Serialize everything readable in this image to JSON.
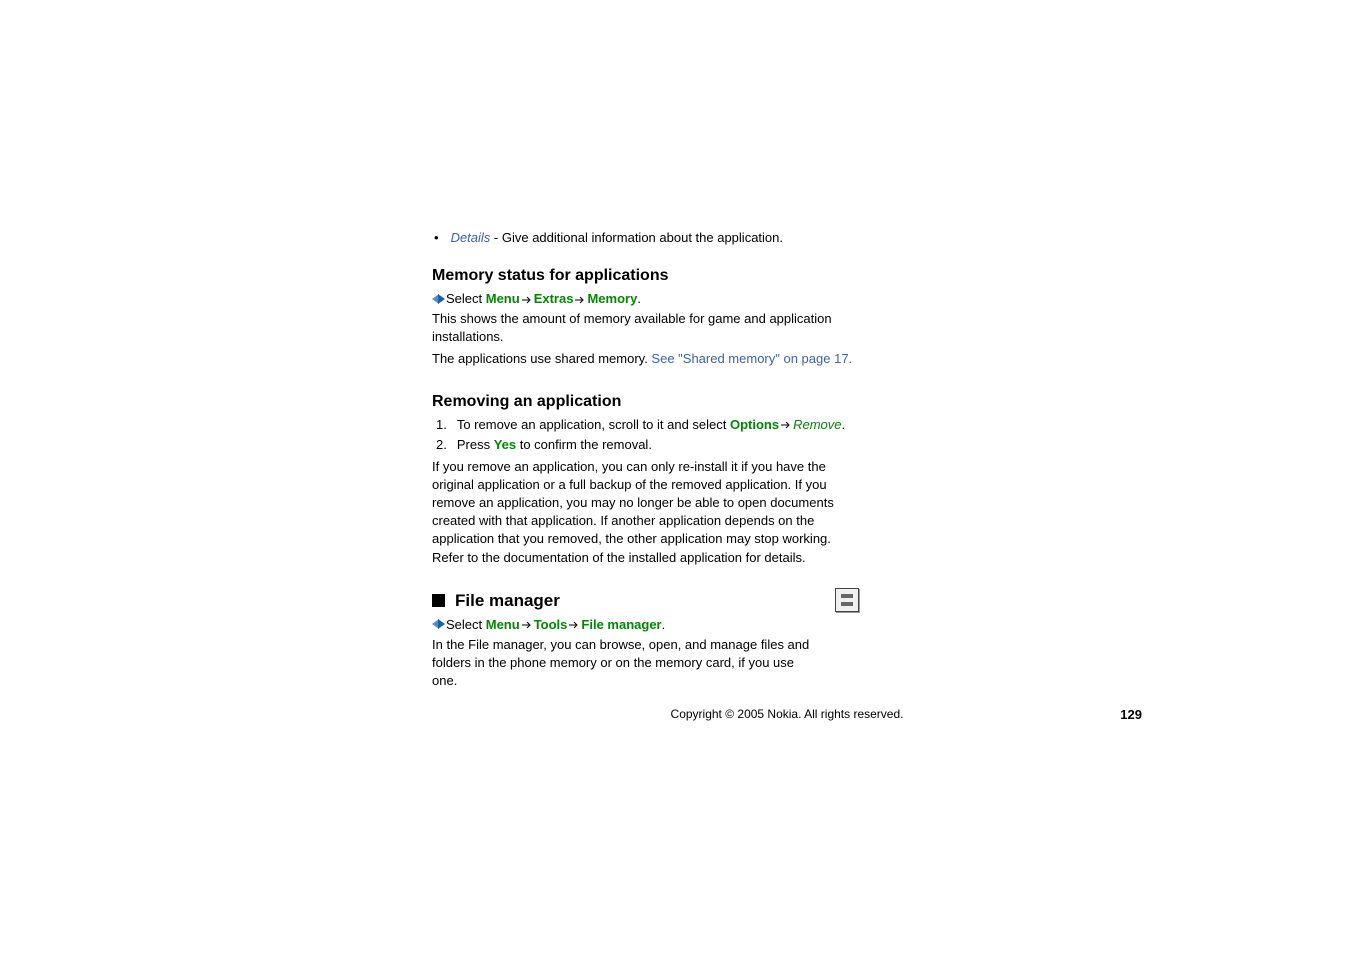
{
  "bullet": {
    "term": "Details",
    "desc": " - Give additional information about the application."
  },
  "section1": {
    "heading": "Memory status for applications",
    "select_label": "Select ",
    "nav": {
      "menu": "Menu",
      "extras": "Extras",
      "memory": "Memory"
    },
    "para1": "This shows the amount of memory available for game and application installations.",
    "para2_pre": "The applications use shared memory. ",
    "para2_link": "See \"Shared memory\" on page 17."
  },
  "section2": {
    "heading": "Removing an application",
    "item1_pre": "To remove an application, scroll to it and select ",
    "item1_opt": "Options",
    "item1_remove": "Remove",
    "item2_pre": "Press ",
    "item2_yes": "Yes",
    "item2_post": " to confirm the removal.",
    "para": "If you remove an application, you can only re-install it if you have the original application or a full backup of the removed application. If you remove an application, you may no longer be able to open documents created with that application. If another application depends on the application that you removed, the other application may stop working. Refer to the documentation of the installed application for details."
  },
  "section3": {
    "heading": "File manager",
    "select_label": "Select ",
    "nav": {
      "menu": "Menu",
      "tools": "Tools",
      "fm": "File manager"
    },
    "para": "In the File manager, you can browse, open, and manage files and folders in the phone memory or on the memory card, if you use one."
  },
  "footer": {
    "copyright": "Copyright © 2005 Nokia. All rights reserved.",
    "page": "129"
  }
}
